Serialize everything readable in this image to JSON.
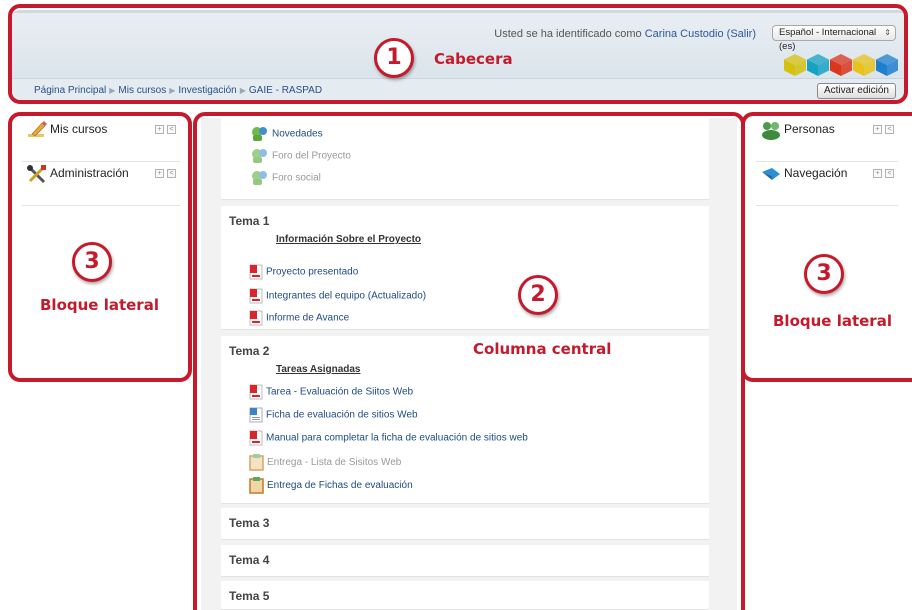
{
  "header": {
    "login_prefix": "Usted se ha identificado como",
    "user_name": "Carina Custodio",
    "logout": "(Salir)",
    "language": "Español - Internacional (es)",
    "breadcrumb": [
      "Página Principal",
      "Mis cursos",
      "Investigación",
      "GAIE - RASPAD"
    ],
    "edit_button": "Activar edición",
    "cube_colors": [
      "#d4c10f",
      "#17a2c4",
      "#d9361c",
      "#e8c21b",
      "#1f7fcf"
    ]
  },
  "left_blocks": [
    {
      "title": "Mis cursos",
      "icon": "pencil-icon"
    },
    {
      "title": "Administración",
      "icon": "tools-icon"
    }
  ],
  "right_blocks": [
    {
      "title": "Personas",
      "icon": "people-icon"
    },
    {
      "title": "Navegación",
      "icon": "navigation-arrow-icon"
    }
  ],
  "block_controls": {
    "expand": "+",
    "dock": "<"
  },
  "center": {
    "general_items": [
      {
        "label": "Novedades",
        "icon": "forum-icon",
        "dim": false
      },
      {
        "label": "Foro del Proyecto",
        "icon": "forum-icon",
        "dim": true
      },
      {
        "label": "Foro social",
        "icon": "forum-icon",
        "dim": true
      }
    ],
    "sections": [
      {
        "title": "Tema 1",
        "subheading": "Información Sobre el Proyecto",
        "items": [
          {
            "label": "Proyecto presentado",
            "icon": "pdf-icon",
            "dim": false
          },
          {
            "label": "Integrantes del equipo (Actualizado)",
            "icon": "pdf-icon",
            "dim": false
          },
          {
            "label": "Informe de Avance",
            "icon": "pdf-icon",
            "dim": false
          }
        ]
      },
      {
        "title": "Tema 2",
        "subheading": "Tareas Asignadas",
        "items": [
          {
            "label": "Tarea - Evaluación de Siitos Web",
            "icon": "pdf-icon",
            "dim": false
          },
          {
            "label": "Ficha de evaluación de sitios Web",
            "icon": "document-icon",
            "dim": false
          },
          {
            "label": "Manual para completar la ficha de evaluación de sitios web",
            "icon": "pdf-icon",
            "dim": false
          },
          {
            "label": "Entrega - Lista de Sisitos Web",
            "icon": "assignment-icon",
            "dim": true
          },
          {
            "label": "Entrega de Fichas de evaluación",
            "icon": "assignment-icon",
            "dim": false
          }
        ]
      },
      {
        "title": "Tema 3"
      },
      {
        "title": "Tema 4"
      },
      {
        "title": "Tema 5"
      }
    ]
  },
  "annotations": [
    {
      "number": "1",
      "label": "Cabecera"
    },
    {
      "number": "2",
      "label": "Columna central"
    },
    {
      "number": "3",
      "label": "Bloque lateral"
    },
    {
      "number": "3",
      "label": "Bloque lateral"
    }
  ],
  "annotation_color": "#c41a2c"
}
